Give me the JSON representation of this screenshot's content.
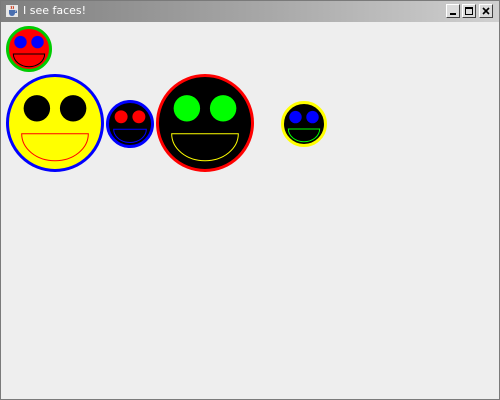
{
  "window": {
    "title": "I see faces!",
    "app_icon": "java-cup-icon",
    "controls": [
      "minimize-icon",
      "maximize-icon",
      "close-icon"
    ]
  },
  "colors": {
    "canvas_background": "#eeeeee",
    "titlebar_text": "#ffffff"
  },
  "faces": [
    {
      "name": "face-red-small",
      "face": "#ff0000",
      "border": "#00cc00",
      "eyes": "#0000ff",
      "mouth": "#ff0000",
      "mouth_line": "#000000"
    },
    {
      "name": "face-yellow-large",
      "face": "#ffff00",
      "border": "#0000ff",
      "eyes": "#000000",
      "mouth": "#ffff00",
      "mouth_line": "#ff0000"
    },
    {
      "name": "face-black-blue",
      "face": "#000000",
      "border": "#0000ff",
      "eyes": "#ff0000",
      "mouth": "#000000",
      "mouth_line": "#0000ff"
    },
    {
      "name": "face-black-red",
      "face": "#000000",
      "border": "#ff0000",
      "eyes": "#00ff00",
      "mouth": "#000000",
      "mouth_line": "#ffff00"
    },
    {
      "name": "face-black-yellow",
      "face": "#000000",
      "border": "#ffff00",
      "eyes": "#0000ff",
      "mouth": "#000000",
      "mouth_line": "#00ff00"
    }
  ]
}
